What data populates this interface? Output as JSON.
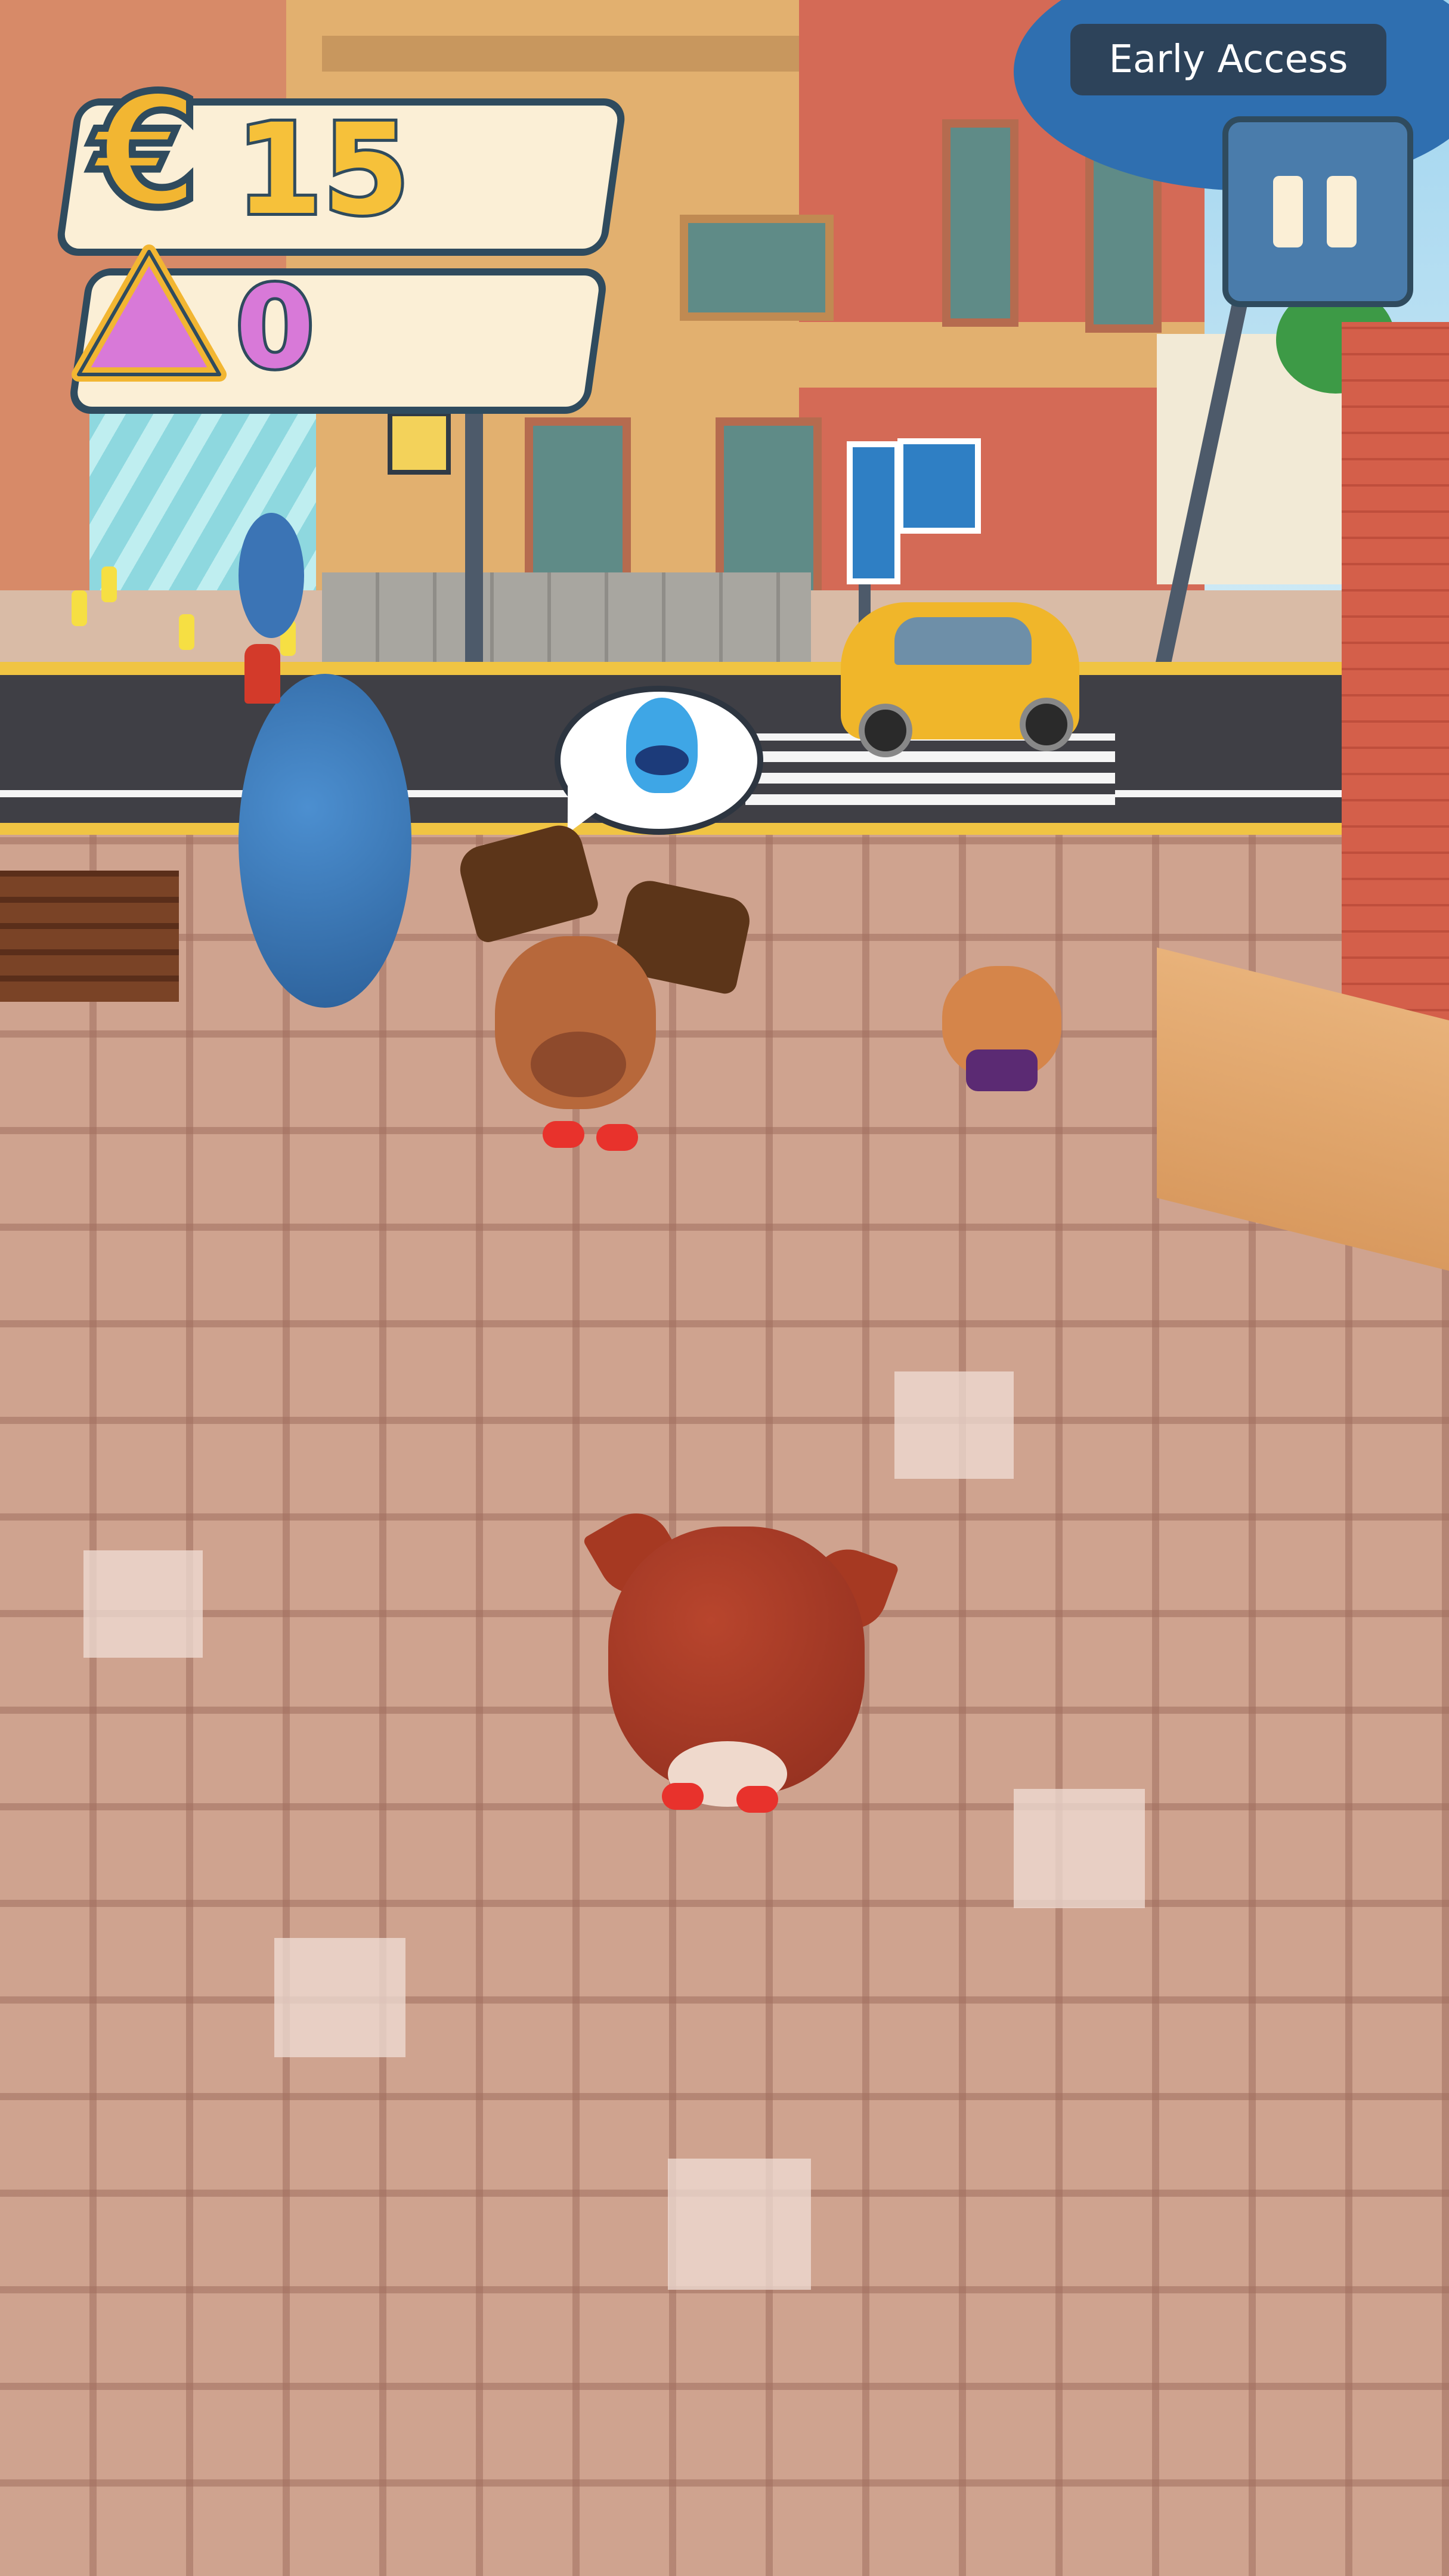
{
  "hud": {
    "currency_icon": "€",
    "coins": "15",
    "triangles": "0",
    "early_access_label": "Early Access",
    "pause_icon": "pause-icon"
  },
  "colors": {
    "panel_bg": "#fbefd6",
    "panel_border": "#2f4b5e",
    "coin_gold": "#f6c13a",
    "triangle_pink": "#d879d8",
    "pause_blue": "#4a7cab"
  }
}
